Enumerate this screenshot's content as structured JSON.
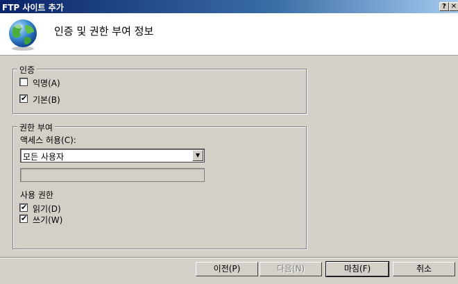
{
  "window": {
    "title": "FTP 사이트 추가",
    "help_button": "?",
    "close_button": "✕"
  },
  "header": {
    "icon": "globe-icon",
    "title": "인증 및 권한 부여 정보"
  },
  "authentication": {
    "legend": "인증",
    "anonymous": {
      "label": "익명(A)",
      "checked": false
    },
    "basic": {
      "label": "기본(B)",
      "checked": true
    }
  },
  "authorization": {
    "legend": "권한 부여",
    "access_label": "액세스 허용(C):",
    "access_value": "모든 사용자",
    "text_value": "",
    "permissions_label": "사용 권한",
    "read": {
      "label": "읽기(D)",
      "checked": true
    },
    "write": {
      "label": "쓰기(W)",
      "checked": true
    }
  },
  "buttons": {
    "previous": "이전(P)",
    "next": "다음(N)",
    "finish": "마침(F)",
    "cancel": "취소"
  }
}
